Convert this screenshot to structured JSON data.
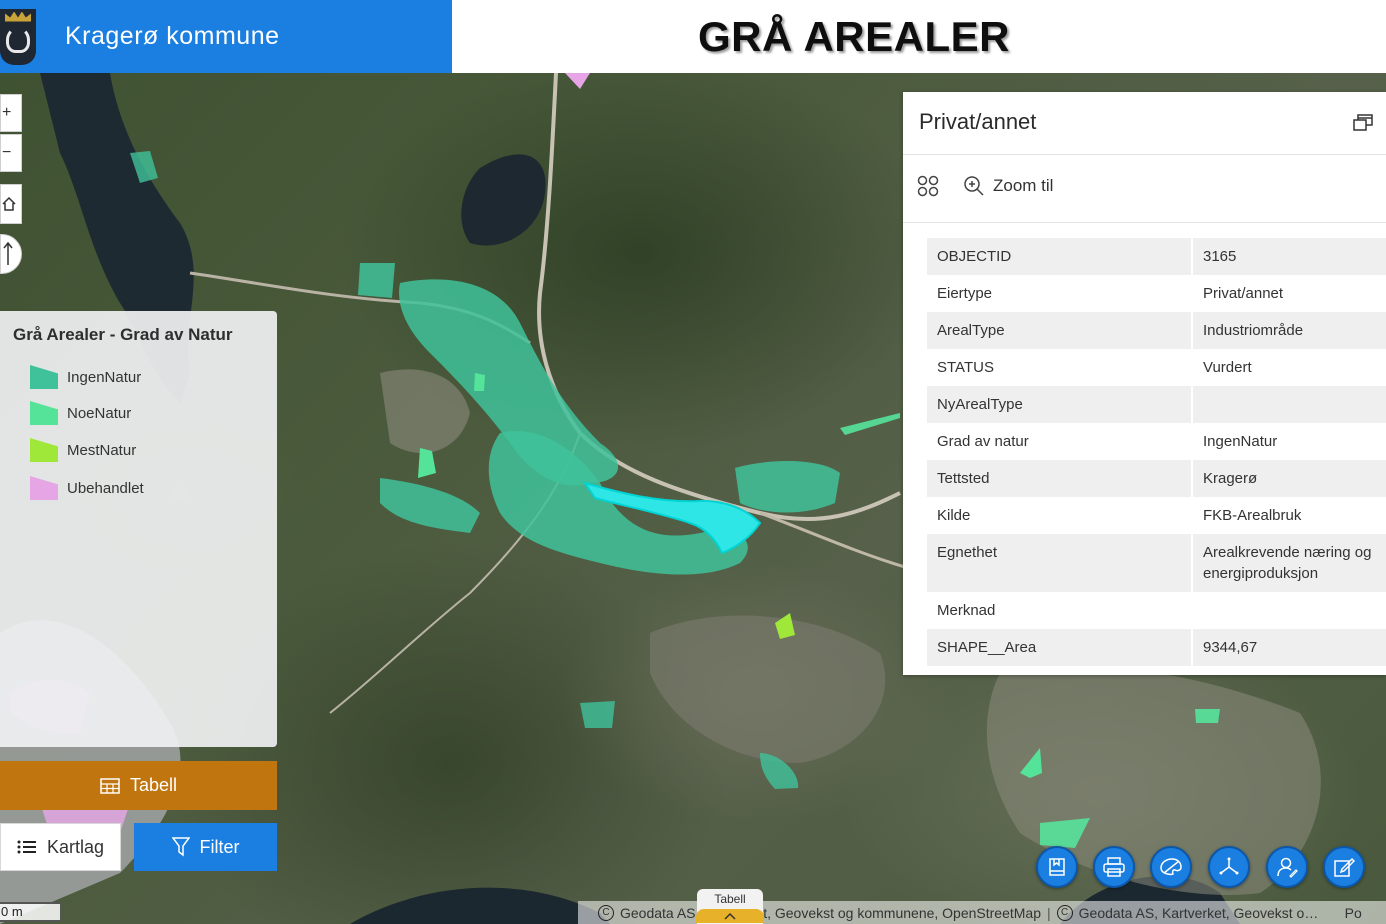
{
  "header": {
    "app_title": "Kragerø kommune",
    "page_headline": "GRÅ AREALER"
  },
  "map_controls": {
    "zoom_in": "+",
    "zoom_out": "−"
  },
  "legend": {
    "title": "Grå Arealer - Grad av Natur",
    "items": [
      {
        "label": "IngenNatur",
        "color": "#3fc29a"
      },
      {
        "label": "NoeNatur",
        "color": "#55e39a"
      },
      {
        "label": "MestNatur",
        "color": "#9fe83a"
      },
      {
        "label": "Ubehandlet",
        "color": "#e6a6e6"
      }
    ]
  },
  "buttons": {
    "tabell": "Tabell",
    "kartlag": "Kartlag",
    "filter": "Filter"
  },
  "scale": {
    "label": "0 m"
  },
  "attribution": {
    "part1": "Geodata AS, Kartverket, Geovekst og kommunene, OpenStreetMap",
    "part2": "Geodata AS, Kartverket, Geovekst og kommunene, OpenStreetMap",
    "trailing": "Po"
  },
  "tab_handle": {
    "label": "Tabell"
  },
  "colors": {
    "accent_blue": "#1a7fe0",
    "accent_orange": "#c0750f",
    "highlight_cyan": "#2ee6e6"
  },
  "popup": {
    "title": "Privat/annet",
    "zoom_to": "Zoom til",
    "rows": [
      {
        "key": "OBJECTID",
        "value": "3165"
      },
      {
        "key": "Eiertype",
        "value": "Privat/annet"
      },
      {
        "key": "ArealType",
        "value": "Industriområde"
      },
      {
        "key": "STATUS",
        "value": "Vurdert"
      },
      {
        "key": "NyArealType",
        "value": ""
      },
      {
        "key": "Grad av natur",
        "value": "IngenNatur"
      },
      {
        "key": "Tettsted",
        "value": "Kragerø"
      },
      {
        "key": "Kilde",
        "value": "FKB-Arealbruk"
      },
      {
        "key": "Egnethet",
        "value": "Arealkrevende næring og energiproduksjon"
      },
      {
        "key": "Merknad",
        "value": ""
      },
      {
        "key": "SHAPE__Area",
        "value": "9344,67"
      }
    ]
  },
  "tools": [
    {
      "icon": "bookmark-icon"
    },
    {
      "icon": "print-icon"
    },
    {
      "icon": "basemap-icon"
    },
    {
      "icon": "measure-icon"
    },
    {
      "icon": "user-icon"
    },
    {
      "icon": "edit-icon"
    }
  ]
}
